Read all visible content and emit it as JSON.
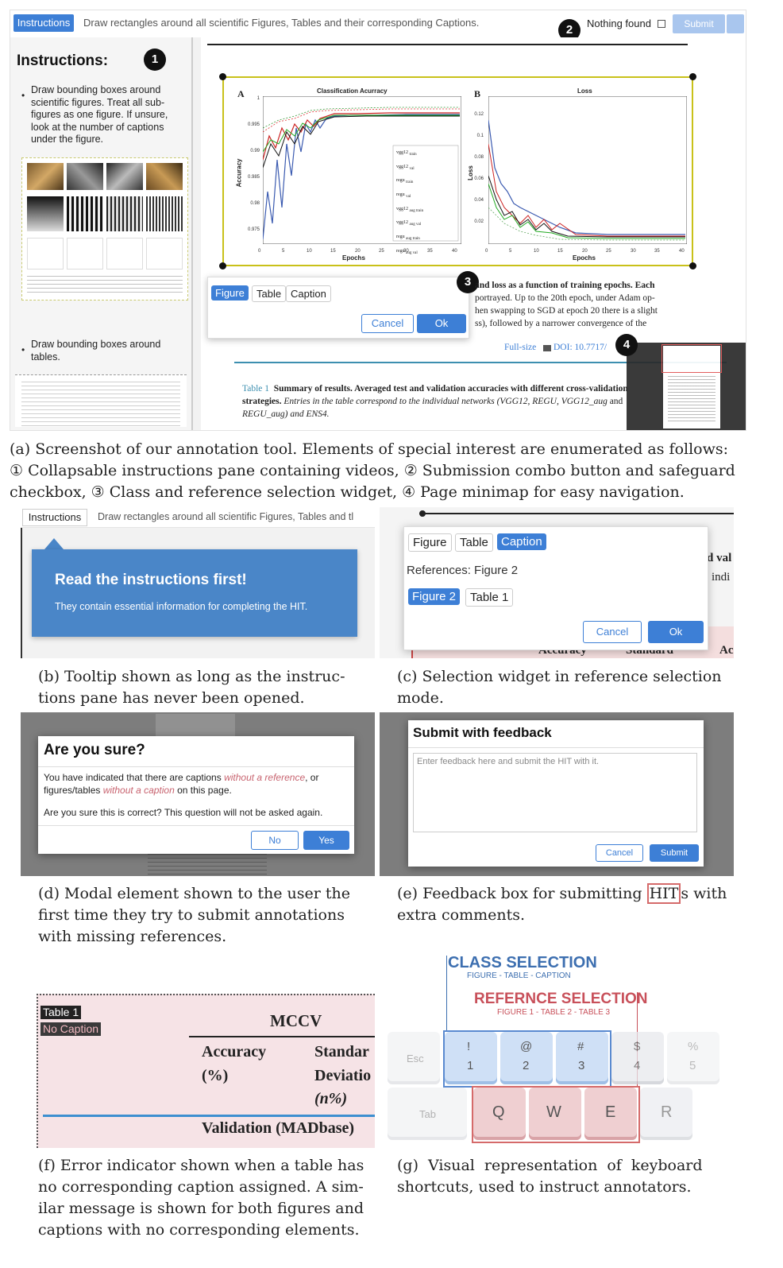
{
  "panel_a": {
    "instructions_btn": "Instructions",
    "task_text": "Draw rectangles around all scientific Figures, Tables and their corresponding Captions.",
    "nothing_found": "Nothing found",
    "submit_btn": "Submit",
    "pane_title": "Instructions:",
    "bullet1": "Draw bounding boxes around scientific figures. Treat all sub-figures as one figure. If unsure, look at the number of captions under the figure.",
    "bullet2": "Draw bounding boxes around tables.",
    "markers": [
      "1",
      "2",
      "3",
      "4"
    ],
    "chart_a": {
      "label": "A",
      "title": "Classification Acurracy",
      "xlabel": "Epochs",
      "ylabel": "Accuracy",
      "yticks": [
        "1",
        "0.995",
        "0.99",
        "0.985",
        "0.98",
        "0.975"
      ],
      "xticks": [
        "0",
        "5",
        "10",
        "15",
        "20",
        "25",
        "30",
        "35",
        "40"
      ]
    },
    "chart_b": {
      "label": "B",
      "title": "Loss",
      "xlabel": "Epochs",
      "ylabel": "Loss",
      "yticks": [
        "0.12",
        "0.1",
        "0.08",
        "0.06",
        "0.04",
        "0.02"
      ],
      "xticks": [
        "0",
        "5",
        "10",
        "15",
        "20",
        "25",
        "30",
        "35",
        "40"
      ]
    },
    "legend": [
      {
        "n": "vgg12",
        "s": "train"
      },
      {
        "n": "vgg12",
        "s": "val"
      },
      {
        "n": "regu",
        "s": "train"
      },
      {
        "n": "regu",
        "s": "val"
      },
      {
        "n": "vgg12",
        "s": "aug train"
      },
      {
        "n": "vgg12",
        "s": "aug val"
      },
      {
        "n": "regu",
        "s": "aug train"
      },
      {
        "n": "regu",
        "s": "aug val"
      }
    ],
    "widget": {
      "figure": "Figure",
      "table": "Table",
      "caption": "Caption",
      "cancel": "Cancel",
      "ok": "Ok"
    },
    "fig_caption_lines": [
      "and loss as a function of training epochs. Each",
      "portrayed. Up to the 20th epoch, under Adam op-",
      "hen swapping to SGD at epoch 20 there is a slight",
      "ss), followed by a narrower convergence of the"
    ],
    "fullsize": "Full-size",
    "doi": "DOI: 10.7717/",
    "table_label": "Table 1",
    "table_caption_bold": "Summary of results. Averaged test and validation accuracies with different cross-",
    "table_caption_bold2": "validation",
    "table_caption_line2a": "strategies.",
    "table_caption_line2b": " Entries in the table correspond to the individual networks (VGG12, REGU, VGG12_aug",
    "table_caption_line2c": " and",
    "table_caption_line3": "REGU_aug) and ENS4."
  },
  "caption_a": [
    "(a) Screenshot of our annotation tool. Elements of special interest are enumerated as follows:",
    "① Collapsable instructions pane containing videos, ② Submission combo button and safeguard",
    "checkbox, ③ Class and reference selection widget, ④ Page minimap for easy navigation."
  ],
  "panel_b": {
    "instructions_btn": "Instructions",
    "task_text": "Draw rectangles around all scientific Figures, Tables and tl",
    "tooltip_title": "Read the instructions first!",
    "tooltip_text": "They contain essential information for completing the HIT."
  },
  "caption_b": [
    "(b) Tooltip shown as long as the instruc-",
    "tions pane has never been opened."
  ],
  "panel_c": {
    "figure": "Figure",
    "table": "Table",
    "caption": "Caption",
    "references": "References: Figure 2",
    "ref1": "Figure 2",
    "ref2": "Table 1",
    "cancel": "Cancel",
    "ok": "Ok",
    "bg_text1": "d val",
    "bg_text2": "indi",
    "bg_col1": "Accuracy",
    "bg_col2": "Standard",
    "bg_col3": "Ac"
  },
  "caption_c": [
    "(c) Selection widget in reference selection",
    "mode."
  ],
  "panel_d": {
    "title": "Are you sure?",
    "line1a": "You have indicated that there are captions ",
    "line1b": "without a reference",
    "line1c": ", or",
    "line2a": "figures/tables ",
    "line2b": "without a caption",
    "line2c": " on this page.",
    "line3": "Are you sure this is correct? This question will not be asked again.",
    "no": "No",
    "yes": "Yes"
  },
  "caption_d": [
    "(d) Modal element shown to the user the",
    "first time they try to submit annotations",
    "with missing references."
  ],
  "panel_e": {
    "title": "Submit with feedback",
    "placeholder": "Enter feedback here and submit the HIT with it.",
    "cancel": "Cancel",
    "submit": "Submit"
  },
  "caption_e": {
    "a": "(e) Feedback box for submitting ",
    "b": "HIT",
    "c": "s with",
    "d": "extra comments."
  },
  "panel_f": {
    "tag1": "Table 1",
    "tag2": "No Caption",
    "mccv": "MCCV",
    "col1a": "Accuracy",
    "col1b": "(%)",
    "col2a": "Standar",
    "col2b": "Deviatio",
    "col2c": "(n%)",
    "row": "Validation (MADbase)"
  },
  "caption_f": [
    "(f) Error indicator shown when a table has",
    "no corresponding caption assigned. A sim-",
    "ilar message is shown for both figures and",
    "captions with no corresponding elements."
  ],
  "panel_g": {
    "class_title": "CLASS SELECTION",
    "class_sub": "FIGURE - TABLE - CAPTION",
    "ref_title": "REFERNCE SELECTION",
    "ref_sub": "FIGURE 1 - TABLE 2 - TABLE 3",
    "keys_top": [
      {
        "s": "Esc",
        "n": ""
      },
      {
        "s": "!",
        "n": "1"
      },
      {
        "s": "@",
        "n": "2"
      },
      {
        "s": "#",
        "n": "3"
      },
      {
        "s": "$",
        "n": "4"
      },
      {
        "s": "%",
        "n": "5"
      }
    ],
    "keys_bottom": [
      "Tab",
      "Q",
      "W",
      "E",
      "R"
    ]
  },
  "caption_g": [
    "(g) Visual representation of keyboard",
    "shortcuts, used to instruct annotators."
  ]
}
